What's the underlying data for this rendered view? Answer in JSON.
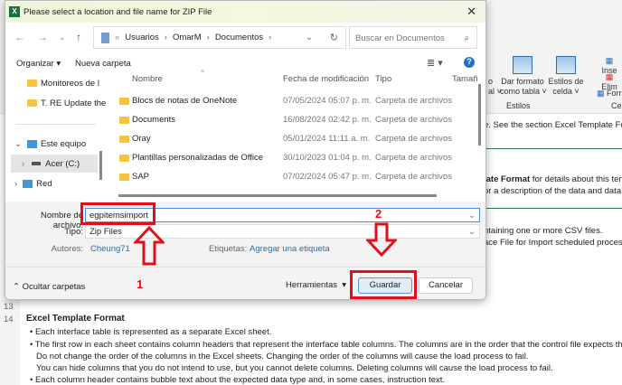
{
  "dialog": {
    "title": "Please select a location and file name for ZIP File",
    "close": "✕",
    "breadcrumb": [
      "«",
      "Usuarios",
      "OmarM",
      "Documentos"
    ],
    "search_placeholder": "Buscar en Documentos",
    "toolbar": {
      "organize": "Organizar ▾",
      "new_folder": "Nueva carpeta",
      "help": "?"
    },
    "nav_pane": [
      "Monitoreos de l",
      "T. RE Update the",
      "Este equipo",
      "Acer (C:)",
      "Red"
    ],
    "columns": [
      "Nombre",
      "Fecha de modificación",
      "Tipo",
      "Tamañ"
    ],
    "files": [
      {
        "name": "Blocs de notas de OneNote",
        "date": "07/05/2024 05:07 p. m.",
        "type": "Carpeta de archivos"
      },
      {
        "name": "Documents",
        "date": "16/08/2024 02:42 p. m.",
        "type": "Carpeta de archivos"
      },
      {
        "name": "Oray",
        "date": "05/01/2024 11:11 a. m.",
        "type": "Carpeta de archivos"
      },
      {
        "name": "Plantillas personalizadas de Office",
        "date": "30/10/2023 01:04 p. m.",
        "type": "Carpeta de archivos"
      },
      {
        "name": "SAP",
        "date": "07/02/2024 05:47 p. m.",
        "type": "Carpeta de archivos"
      }
    ],
    "filename_label": "Nombre de archivo:",
    "filename": "egpitemsimport",
    "type_label": "Tipo:",
    "type_value": "Zip Files",
    "authors_label": "Autores:",
    "authors_value": "Cheung71",
    "tags_label": "Etiquetas:",
    "tags_value": "Agregar una etiqueta",
    "hide_folders": "Ocultar carpetas",
    "tools": "Herramientas",
    "save": "Guardar",
    "cancel": "Cancelar"
  },
  "annotations": {
    "step1": "1",
    "step2": "2",
    "color": "#e0101a"
  },
  "excel": {
    "ribbon": {
      "format_table": "Dar formato\ncomo tabla ˅",
      "cell_styles": "Estilos de\ncelda ˅",
      "styles_group": "Estilos",
      "partial_left": "o\nal ˅",
      "insert": "Inse",
      "delete": "Elim",
      "format": "Forr",
      "cells_group": "Cel"
    },
    "formula_bar_text": "e. See the section Excel Template Form",
    "lines": [
      "late Format for details about this tem",
      "or a description of the data and data t",
      "ntaining one or more CSV files.",
      "ace File for Import scheduled process"
    ],
    "row_numbers": [
      "13",
      "14"
    ],
    "heading": "Excel Template Format",
    "bullets": [
      "• Each interface table is represented as a separate Excel sheet.",
      "• The first row in each sheet contains column headers that represent the interface table columns. The columns are in the order that the control file expects them",
      "Do not change the order of the columns in the Excel sheets. Changing the order of the columns will cause the load process to fail.",
      "You can hide columns that you do not intend to use, but you cannot delete columns. Deleting columns will cause the load process to fail.",
      "• Each column header contains bubble text about the expected data type and, in some cases, instruction text."
    ]
  }
}
